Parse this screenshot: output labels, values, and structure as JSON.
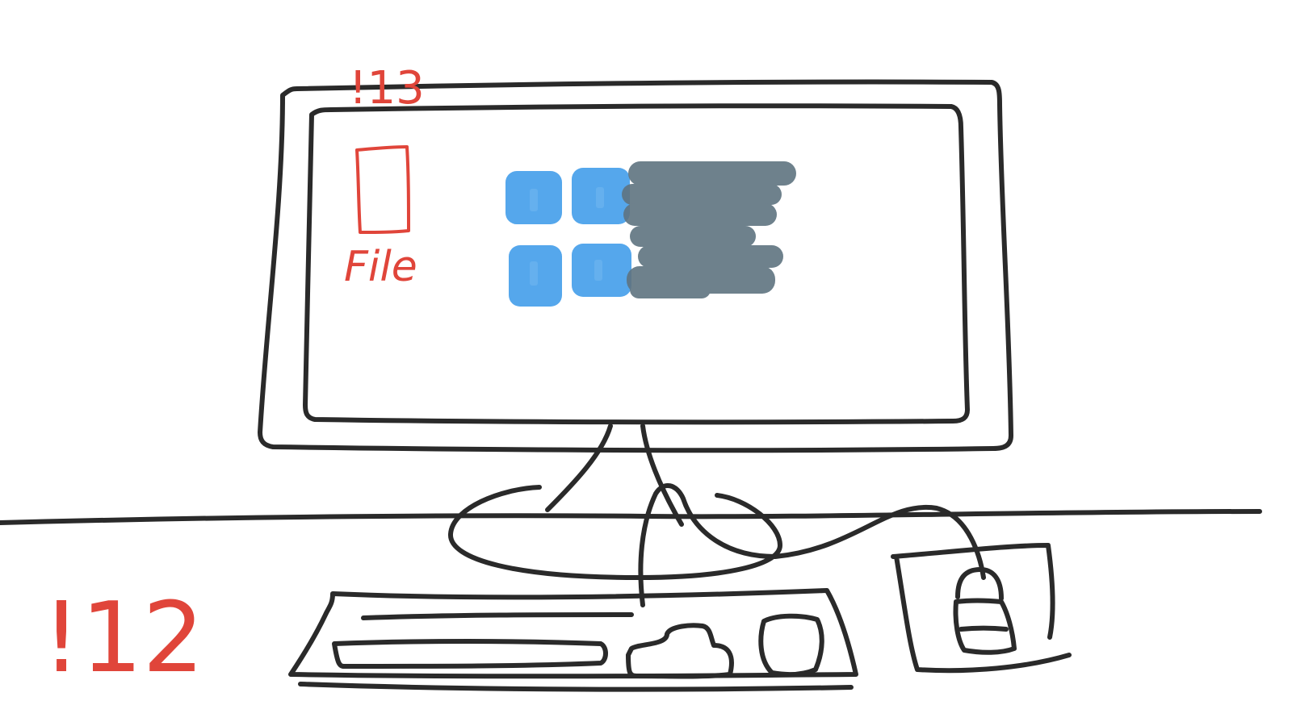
{
  "annotations": {
    "monitor_marker": "!13",
    "desk_marker": "!12"
  },
  "desktop": {
    "file_icon_label": "File"
  },
  "colors": {
    "sketch": "#2a2a2a",
    "annotation": "#e0453a",
    "logo_blue": "#3d9be9",
    "logo_text": "#5f7480"
  },
  "icons": {
    "logo": "windows-logo-icon",
    "file": "file-icon",
    "lock": "lock-icon"
  }
}
